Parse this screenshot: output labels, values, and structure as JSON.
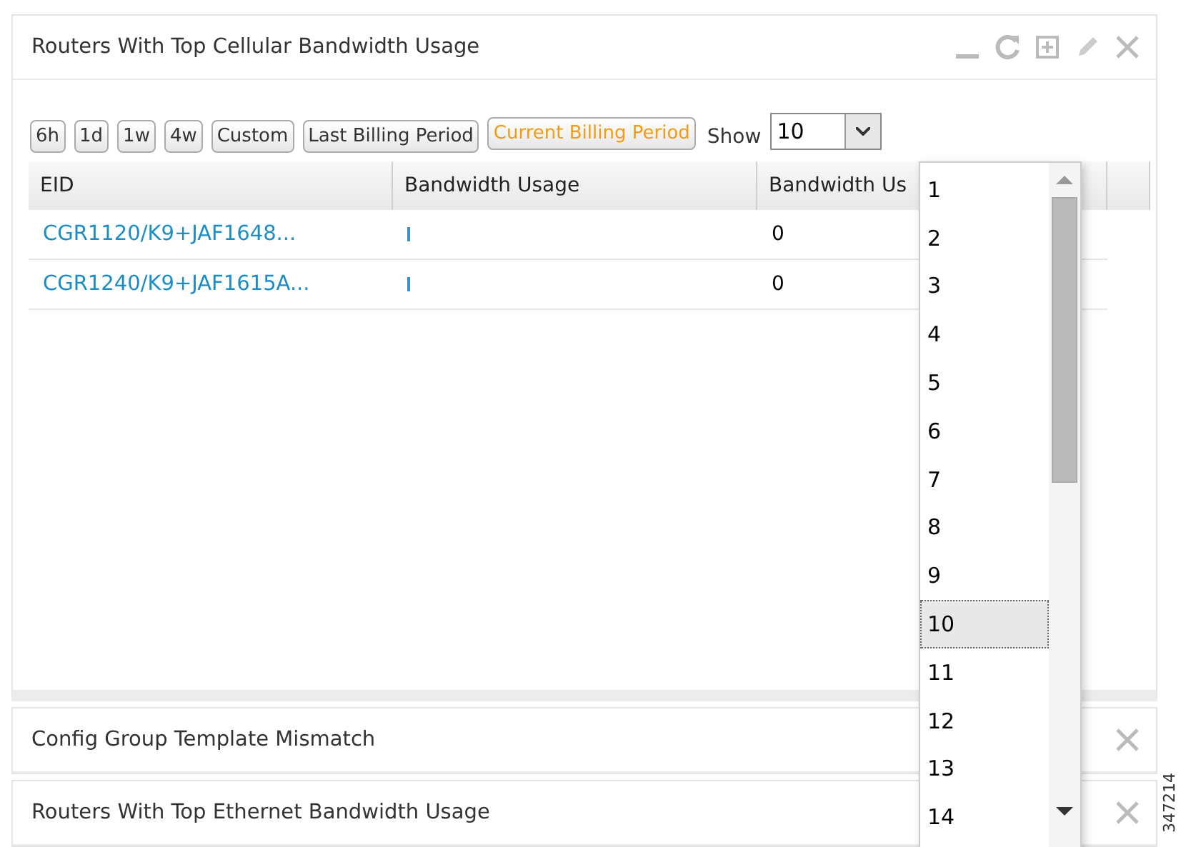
{
  "panels": [
    {
      "title": "Routers With Top Cellular Bandwidth Usage",
      "expanded": true,
      "ranges": [
        {
          "label": "6h",
          "selected": false
        },
        {
          "label": "1d",
          "selected": false
        },
        {
          "label": "1w",
          "selected": false
        },
        {
          "label": "4w",
          "selected": false
        },
        {
          "label": "Custom",
          "selected": false
        },
        {
          "label": "Last Billing Period",
          "selected": false
        },
        {
          "label": "Current Billing Period",
          "selected": true
        }
      ],
      "show": {
        "label": "Show",
        "value": "10",
        "options": [
          {
            "label": "1",
            "selected": false
          },
          {
            "label": "2",
            "selected": false
          },
          {
            "label": "3",
            "selected": false
          },
          {
            "label": "4",
            "selected": false
          },
          {
            "label": "5",
            "selected": false
          },
          {
            "label": "6",
            "selected": false
          },
          {
            "label": "7",
            "selected": false
          },
          {
            "label": "8",
            "selected": false
          },
          {
            "label": "9",
            "selected": false
          },
          {
            "label": "10",
            "selected": true
          },
          {
            "label": "11",
            "selected": false
          },
          {
            "label": "12",
            "selected": false
          },
          {
            "label": "13",
            "selected": false
          },
          {
            "label": "14",
            "selected": false
          }
        ]
      },
      "table": {
        "columns": [
          "EID",
          "Bandwidth Usage",
          "Bandwidth Us"
        ],
        "rows": [
          {
            "eid": "CGR1120/K9+JAF1648...",
            "level": 0.01,
            "usage": "0"
          },
          {
            "eid": "CGR1240/K9+JAF1615A...",
            "level": 0.01,
            "usage": "0"
          }
        ]
      }
    },
    {
      "title": "Config Group Template Mismatch",
      "expanded": false
    },
    {
      "title": "Routers With Top Ethernet Bandwidth Usage",
      "expanded": false
    }
  ],
  "figure_id": "347214"
}
